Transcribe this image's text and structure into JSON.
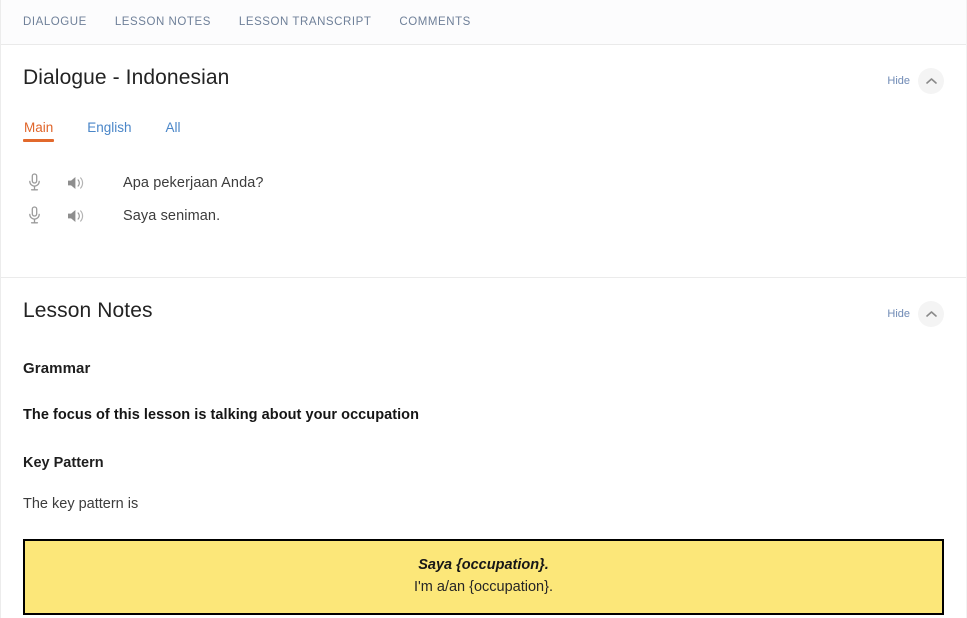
{
  "topnav": {
    "items": [
      {
        "label": "DIALOGUE",
        "name": "nav-dialogue"
      },
      {
        "label": "LESSON NOTES",
        "name": "nav-lesson-notes"
      },
      {
        "label": "LESSON TRANSCRIPT",
        "name": "nav-lesson-transcript"
      },
      {
        "label": "COMMENTS",
        "name": "nav-comments"
      }
    ]
  },
  "dialogue": {
    "title": "Dialogue - Indonesian",
    "hide_label": "Hide",
    "tabs": [
      {
        "label": "Main",
        "active": true
      },
      {
        "label": "English",
        "active": false
      },
      {
        "label": "All",
        "active": false
      }
    ],
    "lines": [
      {
        "text": "Apa pekerjaan Anda?",
        "mic_icon": "microphone-icon",
        "speaker_icon": "speaker-icon"
      },
      {
        "text": "Saya seniman.",
        "mic_icon": "microphone-icon",
        "speaker_icon": "speaker-icon"
      }
    ]
  },
  "lesson_notes": {
    "title": "Lesson Notes",
    "hide_label": "Hide",
    "grammar_heading": "Grammar",
    "focus_text": "The focus of this lesson is talking about your occupation",
    "key_pattern_heading": "Key Pattern",
    "key_pattern_intro": "The key pattern is",
    "key_pattern_box": {
      "target": "Saya {occupation}.",
      "translation": "I'm a/an {occupation}."
    }
  },
  "colors": {
    "accent_orange": "#e2692c",
    "link_blue": "#4a86c8",
    "nav_blue_gray": "#6f8099",
    "highlight_yellow": "#fce779",
    "box_border": "#000000"
  },
  "icons": {
    "collapse": "chevron-up-icon"
  }
}
